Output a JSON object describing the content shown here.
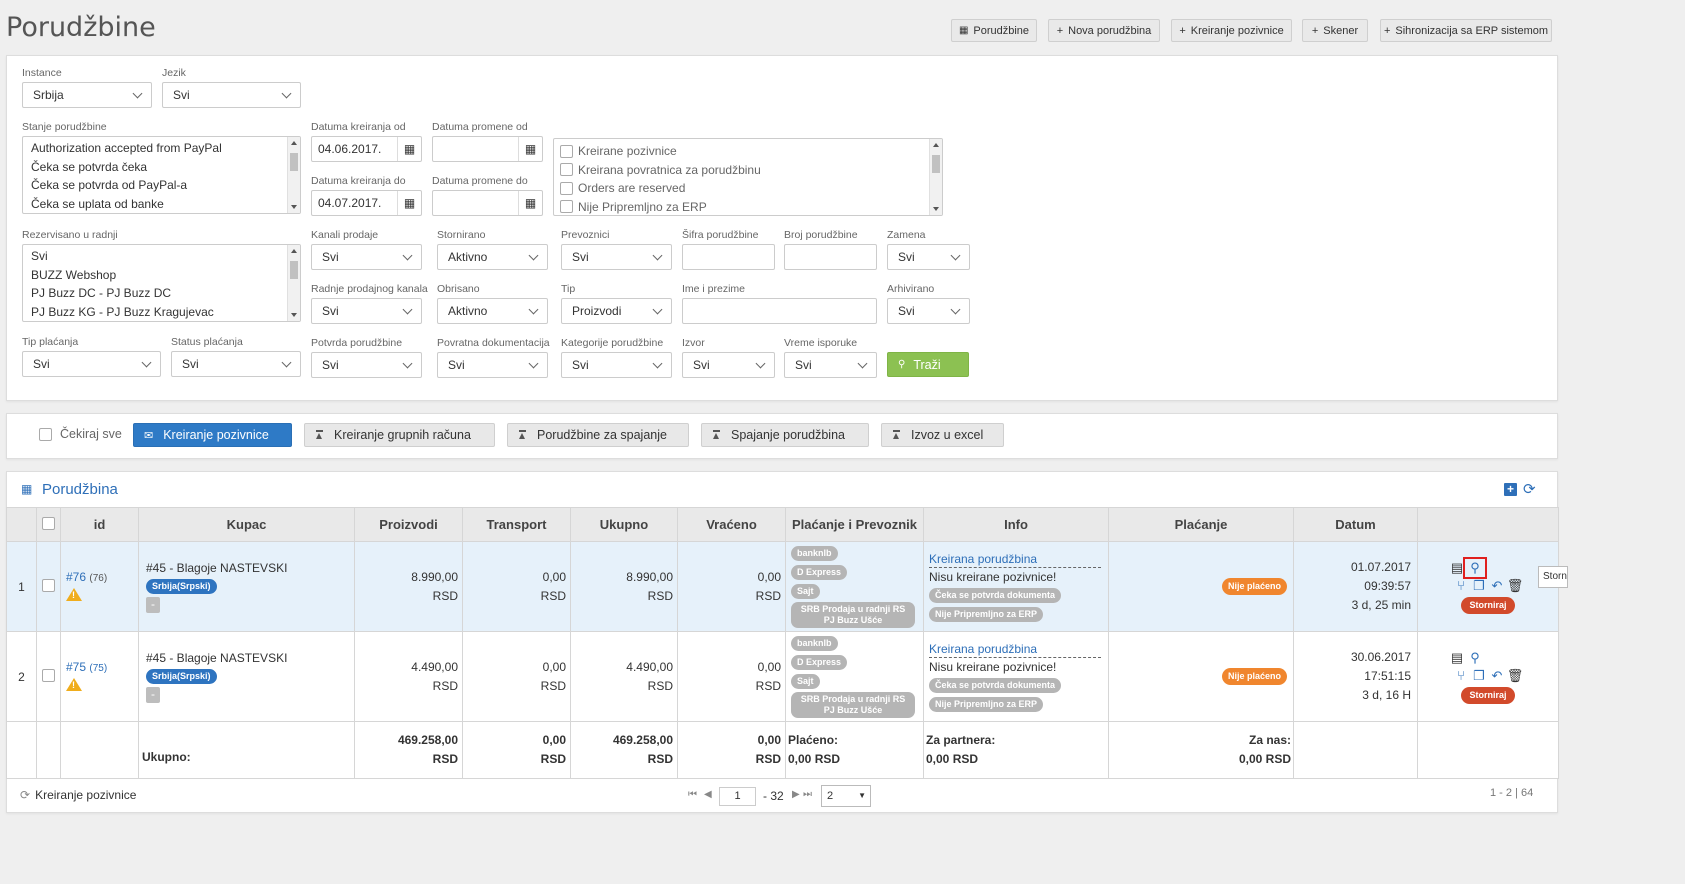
{
  "page": {
    "title": "Porudžbine"
  },
  "header_buttons": {
    "orders": "Porudžbine",
    "new_order": "Nova porudžbina",
    "create_invitation": "Kreiranje pozivnice",
    "scanner": "Skener",
    "erp_sync": "Sihronizacija sa ERP sistemom"
  },
  "filters": {
    "instance": {
      "label": "Instance",
      "value": "Srbija"
    },
    "language": {
      "label": "Jezik",
      "value": "Svi"
    },
    "order_state": {
      "label": "Stanje porudžbine",
      "items": [
        "Authorization accepted from PayPal",
        "Čeka se potvrda čeka",
        "Čeka se potvrda od PayPal-a",
        "Čeka se uplata od banke"
      ]
    },
    "created_from": {
      "label": "Datuma kreiranja od",
      "value": "04.06.2017."
    },
    "changed_from": {
      "label": "Datuma promene od",
      "value": ""
    },
    "created_to": {
      "label": "Datuma kreiranja do",
      "value": "04.07.2017."
    },
    "changed_to": {
      "label": "Datuma promene do",
      "value": ""
    },
    "checklist": [
      "Kreirane pozivnice",
      "Kreirana povratnica za porudžbinu",
      "Orders are reserved",
      "Nije Pripremljno za ERP"
    ],
    "reserved_store": {
      "label": "Rezervisano u radnji",
      "items": [
        "Svi",
        "BUZZ Webshop",
        "PJ Buzz DC - PJ Buzz DC",
        "PJ Buzz KG - PJ Buzz Kragujevac"
      ]
    },
    "sales_channels": {
      "label": "Kanali prodaje",
      "value": "Svi"
    },
    "cancelled": {
      "label": "Stornirano",
      "value": "Aktivno"
    },
    "carriers": {
      "label": "Prevoznici",
      "value": "Svi"
    },
    "order_code": {
      "label": "Šifra porudžbine",
      "value": ""
    },
    "order_number": {
      "label": "Broj porudžbine",
      "value": ""
    },
    "exchange": {
      "label": "Zamena",
      "value": "Svi"
    },
    "channel_stores": {
      "label": "Radnje prodajnog kanala",
      "value": "Svi"
    },
    "deleted": {
      "label": "Obrisano",
      "value": "Aktivno"
    },
    "type": {
      "label": "Tip",
      "value": "Proizvodi"
    },
    "full_name": {
      "label": "Ime i prezime",
      "value": ""
    },
    "archived": {
      "label": "Arhivirano",
      "value": "Svi"
    },
    "payment_type": {
      "label": "Tip plaćanja",
      "value": "Svi"
    },
    "payment_status": {
      "label": "Status plaćanja",
      "value": "Svi"
    },
    "order_confirmation": {
      "label": "Potvrda porudžbine",
      "value": "Svi"
    },
    "return_docs": {
      "label": "Povratna dokumentacija",
      "value": "Svi"
    },
    "order_categories": {
      "label": "Kategorije porudžbine",
      "value": "Svi"
    },
    "source": {
      "label": "Izvor",
      "value": "Svi"
    },
    "delivery_time": {
      "label": "Vreme isporuke",
      "value": "Svi"
    },
    "search_button": "Traži"
  },
  "toolbar": {
    "check_all": "Čekiraj sve",
    "create_invitations": "Kreiranje pozivnice",
    "group_invoice": "Kreiranje grupnih računa",
    "orders_merge": "Porudžbine za spajanje",
    "merge_orders": "Spajanje porudžbina",
    "export_excel": "Izvoz u excel"
  },
  "grid": {
    "title": "Porudžbina",
    "columns": [
      "id",
      "Kupac",
      "Proizvodi",
      "Transport",
      "Ukupno",
      "Vraćeno",
      "Plaćanje i Prevoznik",
      "Info",
      "Plaćanje",
      "Datum"
    ],
    "rows": [
      {
        "n": "1",
        "id": "#76",
        "id_sub": "(76)",
        "customer": "#45 - Blagoje NASTEVSKI",
        "locale": "Srbija(Srpski)",
        "minus": "-",
        "products": "8.990,00",
        "transport": "0,00",
        "total": "8.990,00",
        "returned": "0,00",
        "currency": "RSD",
        "pay_tags": [
          "banknlb",
          "D Express",
          "Sajt"
        ],
        "store_tag_1": "SRB Prodaja u radnji RS",
        "store_tag_2": "PJ Buzz Ušće",
        "info_link": "Kreirana porudžbina",
        "info_text": "Nisu kreirane pozivnice!",
        "info_tags": [
          "Čeka se potvrda dokumenta",
          "Nije Pripremljno za ERP"
        ],
        "payment": "Nije plaćeno",
        "date": "01.07.2017",
        "time": "09:39:57",
        "ago": "3 d, 25 min",
        "storno": "Storniraj"
      },
      {
        "n": "2",
        "id": "#75",
        "id_sub": "(75)",
        "customer": "#45 - Blagoje NASTEVSKI",
        "locale": "Srbija(Srpski)",
        "minus": "-",
        "products": "4.490,00",
        "transport": "0,00",
        "total": "4.490,00",
        "returned": "0,00",
        "currency": "RSD",
        "pay_tags": [
          "banknlb",
          "D Express",
          "Sajt"
        ],
        "store_tag_1": "SRB Prodaja u radnji RS",
        "store_tag_2": "PJ Buzz Ušće",
        "info_link": "Kreirana porudžbina",
        "info_text": "Nisu kreirane pozivnice!",
        "info_tags": [
          "Čeka se potvrda dokumenta",
          "Nije Pripremljno za ERP"
        ],
        "payment": "Nije plaćeno",
        "date": "30.06.2017",
        "time": "17:51:15",
        "ago": "3 d, 16 H",
        "storno": "Storniraj"
      }
    ],
    "totals": {
      "label": "Ukupno:",
      "products": "469.258,00",
      "transport": "0,00",
      "total": "469.258,00",
      "returned": "0,00",
      "currency": "RSD",
      "paid_label": "Plaćeno:",
      "paid_value": "0,00 RSD",
      "partner_label": "Za partnera:",
      "partner_value": "0,00 RSD",
      "us_label": "Za nas:",
      "us_value": "0,00 RSD"
    },
    "tooltip": "Storn"
  },
  "pager": {
    "footer_action": "Kreiranje pozivnice",
    "page": "1",
    "of": "- 32",
    "per_page": "2",
    "range": "1 - 2 | 64"
  },
  "colors": {
    "primary": "#2e7ac6",
    "search": "#8cc152",
    "unpaid": "#f0862e",
    "storno": "#d24a2b",
    "link": "#2e6fb8"
  }
}
